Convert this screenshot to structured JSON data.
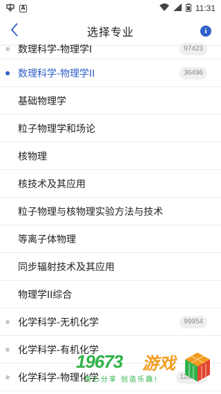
{
  "status_bar": {
    "time": "11:31",
    "left_icons": [
      "notification-app-icon",
      "download-icon"
    ],
    "right_icons": [
      "wifi-icon",
      "signal-icon",
      "battery-icon"
    ]
  },
  "header": {
    "title": "选择专业",
    "back_icon": "chevron-left-icon",
    "info_icon": "info-icon",
    "info_glyph": "i"
  },
  "colors": {
    "accent": "#2f5fc7",
    "dot_inactive": "#c8c8c8",
    "badge_bg": "#efefef",
    "watermark_green": "#2fb24a",
    "watermark_orange": "#f29c1f"
  },
  "list": [
    {
      "label": "数理科学-物理学I",
      "badge": "97423",
      "type": "major",
      "selected": false
    },
    {
      "label": "数理科学-物理学II",
      "badge": "36496",
      "type": "major",
      "selected": true
    },
    {
      "label": "基础物理学",
      "type": "minor"
    },
    {
      "label": "粒子物理学和场论",
      "type": "minor"
    },
    {
      "label": "核物理",
      "type": "minor"
    },
    {
      "label": "核技术及其应用",
      "type": "minor"
    },
    {
      "label": "粒子物理与核物理实验方法与技术",
      "type": "minor"
    },
    {
      "label": "等离子体物理",
      "type": "minor"
    },
    {
      "label": "同步辐射技术及其应用",
      "type": "minor"
    },
    {
      "label": "物理学II综合",
      "type": "minor"
    },
    {
      "label": "化学科学-无机化学",
      "badge": "99954",
      "type": "major",
      "selected": false
    },
    {
      "label": "化学科学-有机化学",
      "badge": "",
      "type": "major",
      "selected": false
    },
    {
      "label": "化学科学-物理化学",
      "badge": "128469",
      "type": "major",
      "selected": false
    }
  ],
  "watermark": {
    "number": "19673",
    "name": "游戏",
    "slogan": "用心分享 创造乐趣!"
  }
}
